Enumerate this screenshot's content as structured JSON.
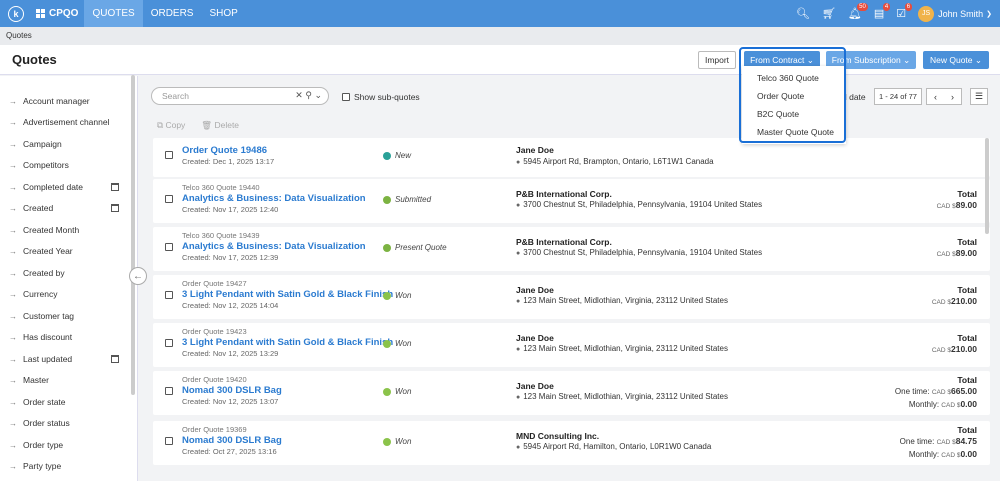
{
  "topbar": {
    "logo": "k",
    "app_name": "CPQO",
    "tabs": [
      "QUOTES",
      "ORDERS",
      "SHOP"
    ],
    "badges": {
      "notifications": "50",
      "tasks": "4",
      "approvals": "6"
    },
    "avatar_initials": "JS",
    "user_name": "John Smith"
  },
  "breadcrumb": "Quotes",
  "header": {
    "title": "Quotes",
    "import_label": "Import",
    "from_contract_label": "From Contract",
    "from_subscription_label": "From Subscription",
    "new_quote_label": "New Quote"
  },
  "dropdown": {
    "items": [
      "Telco 360 Quote",
      "Order Quote",
      "B2C Quote",
      "Master Quote Quote"
    ]
  },
  "sidebar": {
    "items": [
      {
        "label": "Account manager"
      },
      {
        "label": "Advertisement channel"
      },
      {
        "label": "Campaign"
      },
      {
        "label": "Competitors"
      },
      {
        "label": "Completed date"
      },
      {
        "label": "Created"
      },
      {
        "label": "Created Month"
      },
      {
        "label": "Created Year"
      },
      {
        "label": "Created by"
      },
      {
        "label": "Currency"
      },
      {
        "label": "Customer tag"
      },
      {
        "label": "Has discount"
      },
      {
        "label": "Last updated"
      },
      {
        "label": "Master"
      },
      {
        "label": "Order state"
      },
      {
        "label": "Order status"
      },
      {
        "label": "Order type"
      },
      {
        "label": "Party type"
      }
    ]
  },
  "toolbar": {
    "search_placeholder": "Search",
    "show_subquotes_label": "Show sub-quotes",
    "copy_label": "Copy",
    "delete_label": "Delete",
    "sort_label": "d date",
    "pager_label": "1 - 24 of 77"
  },
  "quotes": [
    {
      "type": "",
      "name": "Order Quote 19486",
      "created": "Created: Dec 1, 2025 13:17",
      "status": "New",
      "customer": "Jane Doe",
      "address": "5945 Airport Rd, Brampton, Ontario, L6T1W1 Canada",
      "total_label": "",
      "lines": []
    },
    {
      "type": "Telco 360 Quote 19440",
      "name": "Analytics & Business: Data Visualization",
      "created": "Created: Nov 17, 2025 12:40",
      "status": "Submitted",
      "customer": "P&B International Corp.",
      "address": "3700 Chestnut St, Philadelphia, Pennsylvania, 19104 United States",
      "total_label": "Total",
      "lines": [
        {
          "label": "",
          "currency": "CAD $",
          "amount": "89.00"
        }
      ]
    },
    {
      "type": "Telco 360 Quote 19439",
      "name": "Analytics & Business: Data Visualization",
      "created": "Created: Nov 17, 2025 12:39",
      "status": "Present Quote",
      "customer": "P&B International Corp.",
      "address": "3700 Chestnut St, Philadelphia, Pennsylvania, 19104 United States",
      "total_label": "Total",
      "lines": [
        {
          "label": "",
          "currency": "CAD $",
          "amount": "89.00"
        }
      ]
    },
    {
      "type": "Order Quote 19427",
      "name": "3 Light Pendant with Satin Gold & Black Finish",
      "created": "Created: Nov 12, 2025 14:04",
      "status": "Won",
      "customer": "Jane Doe",
      "address": "123 Main Street, Midlothian, Virginia, 23112 United States",
      "total_label": "Total",
      "lines": [
        {
          "label": "",
          "currency": "CAD $",
          "amount": "210.00"
        }
      ]
    },
    {
      "type": "Order Quote 19423",
      "name": "3 Light Pendant with Satin Gold & Black Finish",
      "created": "Created: Nov 12, 2025 13:29",
      "status": "Won",
      "customer": "Jane Doe",
      "address": "123 Main Street, Midlothian, Virginia, 23112 United States",
      "total_label": "Total",
      "lines": [
        {
          "label": "",
          "currency": "CAD $",
          "amount": "210.00"
        }
      ]
    },
    {
      "type": "Order Quote 19420",
      "name": "Nomad 300 DSLR Bag",
      "created": "Created: Nov 12, 2025 13:07",
      "status": "Won",
      "customer": "Jane Doe",
      "address": "123 Main Street, Midlothian, Virginia, 23112 United States",
      "total_label": "Total",
      "lines": [
        {
          "label": "One time:",
          "currency": "CAD $",
          "amount": "665.00"
        },
        {
          "label": "Monthly:",
          "currency": "CAD $",
          "amount": "0.00"
        }
      ]
    },
    {
      "type": "Order Quote 19369",
      "name": "Nomad 300 DSLR Bag",
      "created": "Created: Oct 27, 2025 13:16",
      "status": "Won",
      "customer": "MND Consulting Inc.",
      "address": "5945 Airport Rd, Hamilton, Ontario, L0R1W0 Canada",
      "total_label": "Total",
      "lines": [
        {
          "label": "One time:",
          "currency": "CAD $",
          "amount": "84.75"
        },
        {
          "label": "Monthly:",
          "currency": "CAD $",
          "amount": "0.00"
        }
      ]
    }
  ],
  "colors": {
    "primary": "#4a90d9",
    "link": "#2b7bd0",
    "status_new": "#2aa198",
    "status_submitted": "#7cb342",
    "status_won": "#8bc34a",
    "highlight": "#1a6fd6"
  }
}
